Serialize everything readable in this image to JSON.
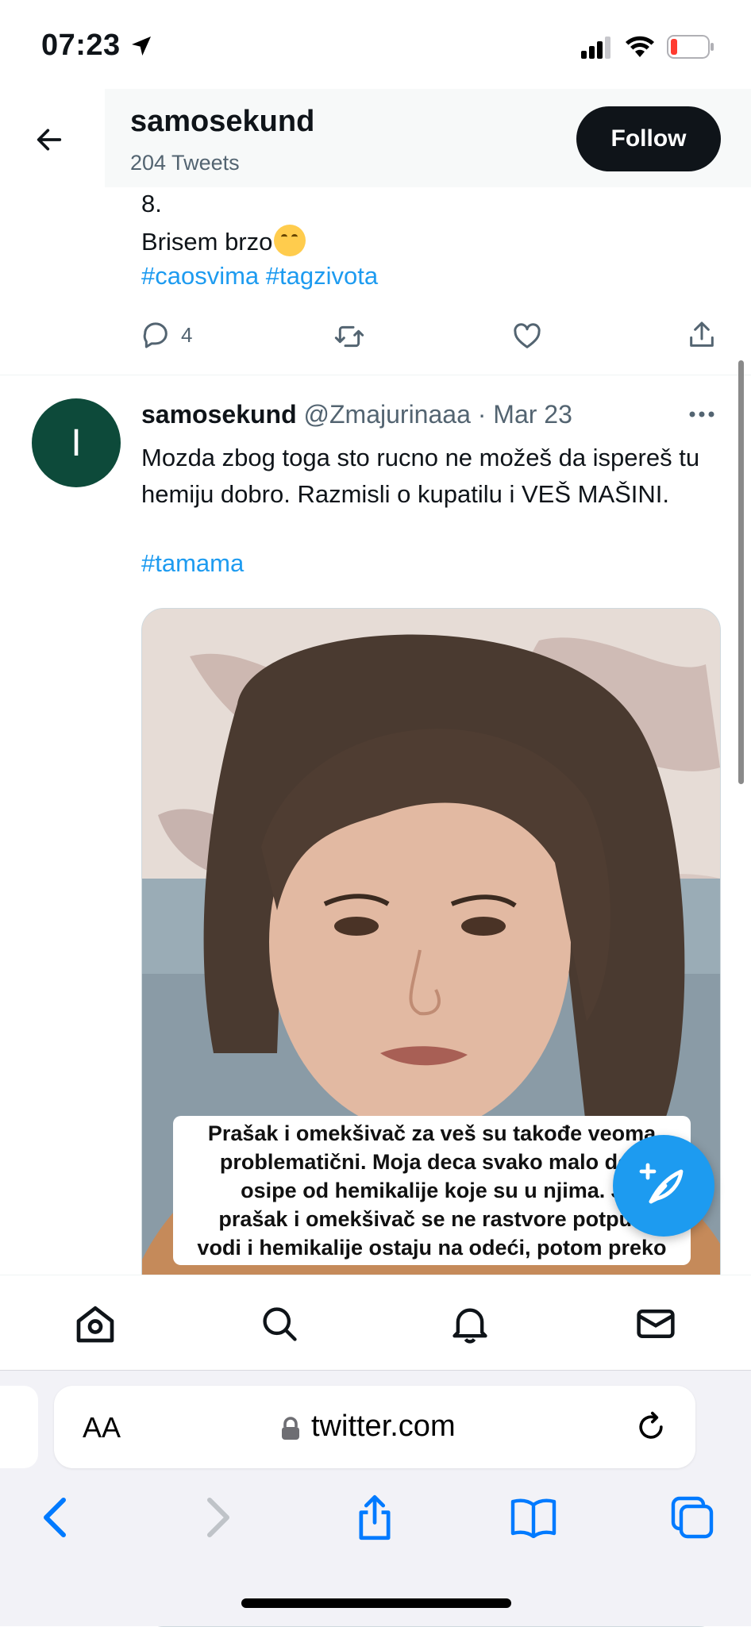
{
  "status_bar": {
    "time": "07:23"
  },
  "header": {
    "name": "samosekund",
    "tweet_count": "204 Tweets",
    "follow_label": "Follow"
  },
  "tweet1": {
    "line1": "8.",
    "line2": "Brisem brzo",
    "hashtags": "#caosvima #tagzivota",
    "reply_count": "4"
  },
  "tweet2": {
    "avatar_letter": "I",
    "name": "samosekund",
    "meta": " @Zmajurinaaa · Mar 23",
    "body": "Mozda zbog toga sto rucno ne možeš da isperеš tu hemiju dobro. Razmisli o kupatilu i VEŠ MAŠINI.",
    "hashtags": "#tamama",
    "media_caption": [
      "Prašak i omekšivač za veš su takođe veoma",
      "problematični. Moja deca svako malo dob",
      "osipe od hemikalije koje su u njima. J",
      "prašak i omekšivač se ne rastvore potpun",
      "vodi i hemikalije ostaju na odeći, potom preko"
    ]
  },
  "browser": {
    "aa_label": "AA",
    "url": "twitter.com"
  },
  "colors": {
    "accent": "#1d9bf0",
    "text": "#0f1419",
    "muted": "#536471",
    "ios_blue": "#007aff"
  }
}
